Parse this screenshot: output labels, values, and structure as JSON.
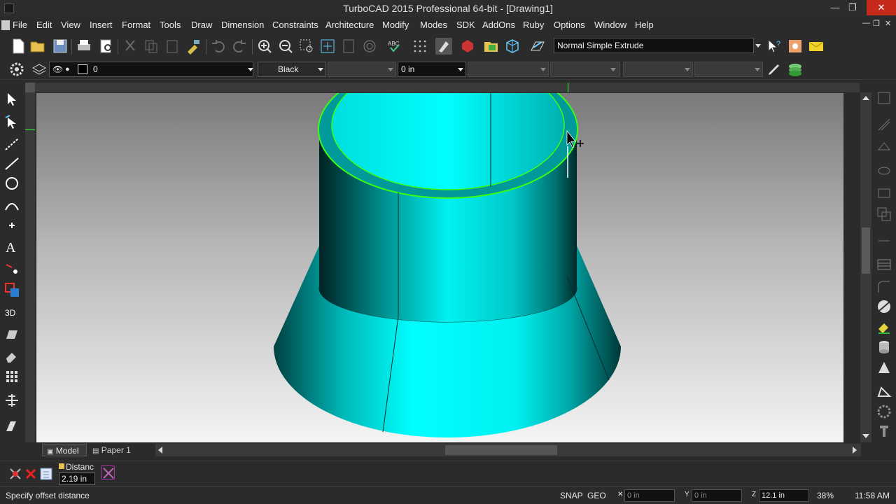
{
  "window": {
    "title": "TurboCAD 2015 Professional 64-bit - [Drawing1]",
    "minimize_glyph": "—",
    "restore_glyph": "❐",
    "close_glyph": "✕"
  },
  "menu": {
    "items": [
      "File",
      "Edit",
      "View",
      "Insert",
      "Format",
      "Tools",
      "Draw",
      "Dimension",
      "Constraints",
      "Architecture",
      "Modify",
      "Modes",
      "SDK",
      "AddOns",
      "Ruby",
      "Options",
      "Window",
      "Help"
    ],
    "mdi_minimize": "—",
    "mdi_restore": "❐",
    "mdi_close": "✕"
  },
  "toolbar": {
    "tool_combo_value": "Normal Simple Extrude"
  },
  "property_bar": {
    "layer_value": "0",
    "color_value": "Black",
    "thickness_value": "0 in"
  },
  "tabs": {
    "model": "Model",
    "paper": "Paper 1"
  },
  "inspector": {
    "distance_label": "Distanc",
    "distance_value": "2.19 in"
  },
  "status": {
    "prompt": "Specify offset distance",
    "snap": "SNAP",
    "geo": "GEO",
    "x_value": "0 in",
    "y_value": "0 in",
    "z_value": "12.1 in",
    "zoom": "38%",
    "time": "11:58 AM"
  },
  "colors": {
    "model_cyan": "#00e6e6",
    "highlight_green": "#39ff14",
    "ui_dark": "#2b2b2b"
  }
}
